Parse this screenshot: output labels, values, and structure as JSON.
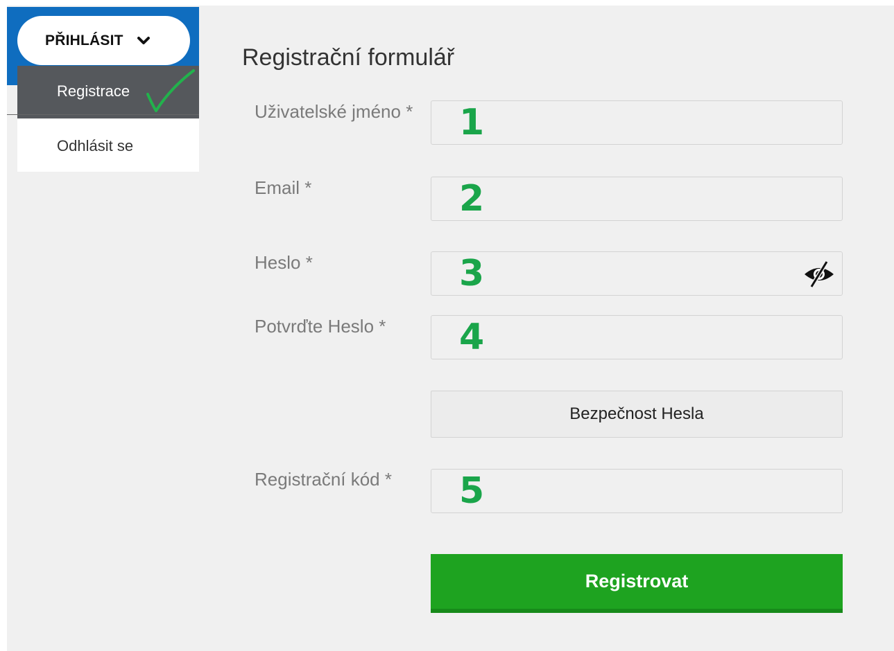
{
  "nav": {
    "login_label": "PŘIHLÁSIT",
    "menu": [
      {
        "label": "Registrace"
      },
      {
        "label": "Odhlásit se"
      }
    ]
  },
  "form": {
    "title": "Registrační formulář",
    "fields": [
      {
        "label": "Uživatelské jméno *",
        "number": "1"
      },
      {
        "label": "Email *",
        "number": "2"
      },
      {
        "label": "Heslo *",
        "number": "3"
      },
      {
        "label": "Potvrďte Heslo *",
        "number": "4"
      },
      {
        "label": "Registrační kód *",
        "number": "5"
      }
    ],
    "strength_label": "Bezpečnost Hesla",
    "submit_label": "Registrovat"
  },
  "colors": {
    "nav_blue": "#0f6dbf",
    "menu_active": "#55585c",
    "annotation_green": "#1aa54a",
    "submit_green": "#1ea320"
  },
  "icons": {
    "dropdown": "chevron-down-icon",
    "password_toggle": "eye-slash-icon",
    "annotation": "checkmark-icon"
  }
}
